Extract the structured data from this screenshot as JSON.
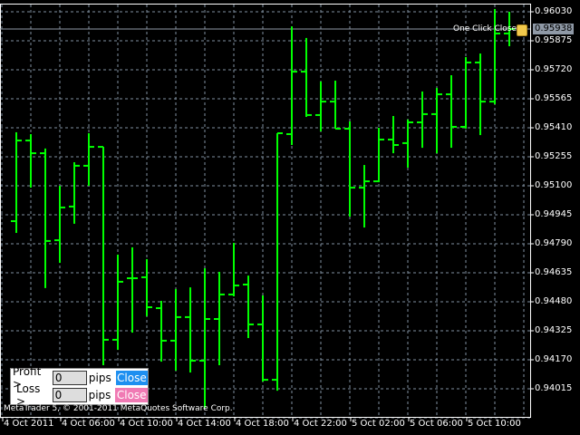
{
  "chart_data": {
    "type": "ohlc",
    "title": "",
    "xlabel": "",
    "ylabel": "",
    "ylim": [
      0.93935,
      0.9613
    ],
    "grid": true,
    "bar_color": "#00ff00",
    "y_ticks": [
      "0.96030",
      "0.95875",
      "0.95720",
      "0.95565",
      "0.95410",
      "0.95255",
      "0.95100",
      "0.94945",
      "0.94790",
      "0.94635",
      "0.94480",
      "0.94325",
      "0.94170",
      "0.94015"
    ],
    "x_ticks": [
      "4 Oct 2011",
      "4 Oct 06:00",
      "4 Oct 10:00",
      "4 Oct 14:00",
      "4 Oct 18:00",
      "4 Oct 22:00",
      "5 Oct 02:00",
      "5 Oct 06:00",
      "5 Oct 10:00"
    ],
    "current_price": "0.95938",
    "bars": [
      [
        0.94911,
        0.95386,
        0.94848,
        0.95342
      ],
      [
        0.95342,
        0.95376,
        0.9509,
        0.95274
      ],
      [
        0.95274,
        0.95299,
        0.94553,
        0.94805
      ],
      [
        0.94809,
        0.951,
        0.94688,
        0.94984
      ],
      [
        0.94989,
        0.95226,
        0.94897,
        0.95207
      ],
      [
        0.95207,
        0.95381,
        0.951,
        0.95308
      ],
      [
        0.95308,
        0.95308,
        0.94141,
        0.94277
      ],
      [
        0.94277,
        0.94732,
        0.94223,
        0.94587
      ],
      [
        0.94606,
        0.94771,
        0.94315,
        0.94606
      ],
      [
        0.94611,
        0.94708,
        0.94403,
        0.94451
      ],
      [
        0.94446,
        0.94485,
        0.9416,
        0.94272
      ],
      [
        0.94272,
        0.94548,
        0.94112,
        0.94398
      ],
      [
        0.94398,
        0.94557,
        0.94102,
        0.94165
      ],
      [
        0.94165,
        0.94659,
        0.93913,
        0.94388
      ],
      [
        0.94388,
        0.9464,
        0.94141,
        0.94519
      ],
      [
        0.94519,
        0.94795,
        0.94509,
        0.94567
      ],
      [
        0.94572,
        0.9462,
        0.94286,
        0.94359
      ],
      [
        0.94359,
        0.94514,
        0.94054,
        0.94063
      ],
      [
        0.94063,
        0.95381,
        0.94005,
        0.95381
      ],
      [
        0.95376,
        0.95952,
        0.95318,
        0.9571
      ],
      [
        0.9571,
        0.9589,
        0.95468,
        0.95478
      ],
      [
        0.95478,
        0.95657,
        0.95391,
        0.9555
      ],
      [
        0.9555,
        0.95662,
        0.95405,
        0.95405
      ],
      [
        0.95405,
        0.95444,
        0.94935,
        0.9509
      ],
      [
        0.9509,
        0.95211,
        0.94877,
        0.95124
      ],
      [
        0.95124,
        0.9541,
        0.95119,
        0.95347
      ],
      [
        0.95347,
        0.95473,
        0.95274,
        0.95318
      ],
      [
        0.95328,
        0.95454,
        0.95197,
        0.95439
      ],
      [
        0.95439,
        0.95604,
        0.95303,
        0.95483
      ],
      [
        0.95483,
        0.95623,
        0.95274,
        0.95589
      ],
      [
        0.95589,
        0.95691,
        0.95303,
        0.95415
      ],
      [
        0.95415,
        0.95788,
        0.95405,
        0.95759
      ],
      [
        0.95759,
        0.95807,
        0.95371,
        0.9555
      ],
      [
        0.9555,
        0.96045,
        0.95536,
        0.95914
      ],
      [
        0.95914,
        0.9603,
        0.95846,
        0.95938
      ]
    ]
  },
  "overlay": {
    "one_click_label": "One Click Close",
    "icon": "scroll-icon"
  },
  "panel": {
    "profit_label": "Profit >",
    "profit_value": "0",
    "loss_label": "Loss >",
    "loss_value": "0",
    "pips_label": "pips",
    "close_label": "Close",
    "profit_close_color": "#1e8ff0",
    "loss_close_color": "#f07ab4"
  },
  "copyright": "MetaTrader 5, © 2001-2011 MetaQuotes Software Corp."
}
